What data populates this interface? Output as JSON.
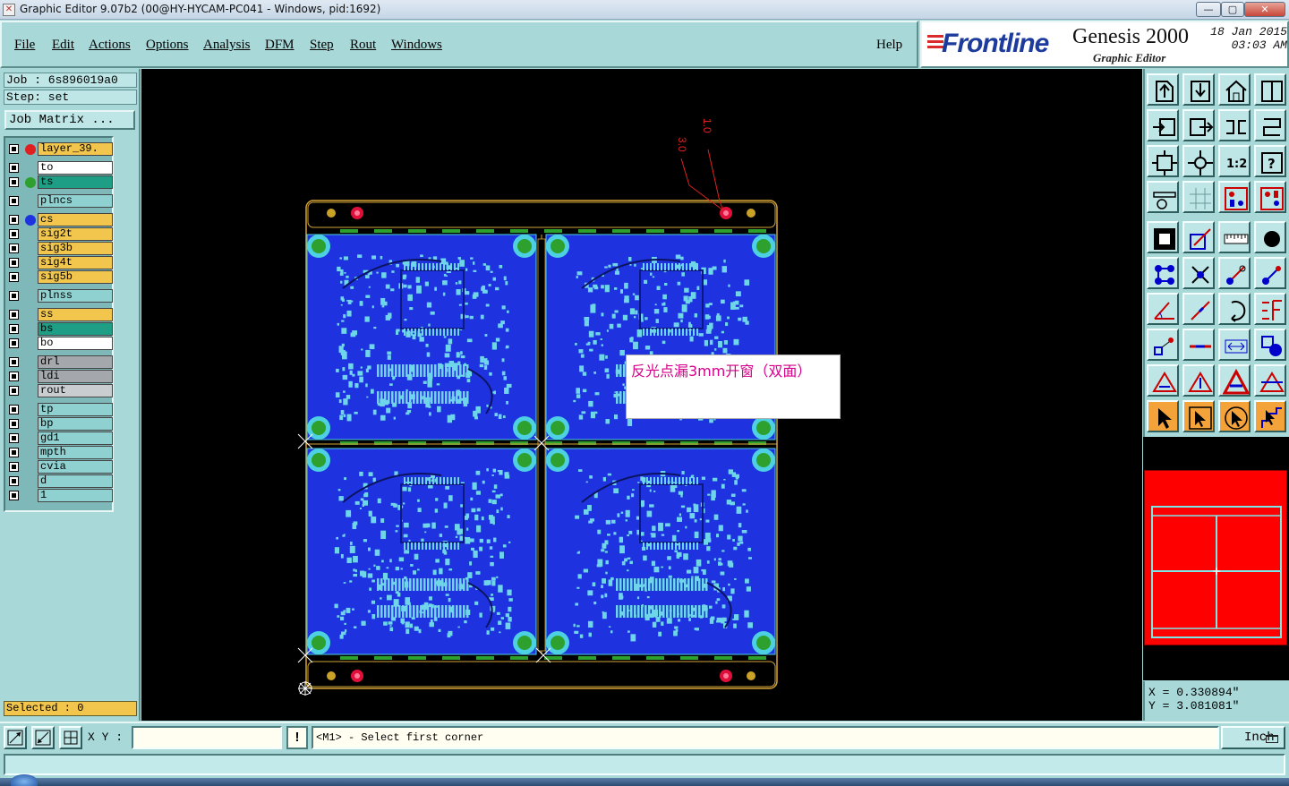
{
  "window": {
    "title": "Graphic Editor 9.07b2 (00@HY-HYCAM-PC041 - Windows, pid:1692)",
    "minimize": "—",
    "maximize": "▢",
    "close": "✕"
  },
  "menu": {
    "file": "File",
    "edit": "Edit",
    "actions": "Actions",
    "options": "Options",
    "analysis": "Analysis",
    "dfm": "DFM",
    "step": "Step",
    "rout": "Rout",
    "windows": "Windows",
    "help": "Help"
  },
  "brand": {
    "logo": "Frontline",
    "product": "Genesis 2000",
    "subtitle": "Graphic Editor",
    "date": "18 Jan 2015",
    "time": "03:03 AM"
  },
  "job": {
    "job_line": "Job : 6s896019a0",
    "step_line": "Step: set",
    "matrix_button": "Job Matrix ..."
  },
  "layers": [
    {
      "name": "layer_39.",
      "color": "#f2c64d",
      "dot": "#e02020"
    },
    {
      "name": "to",
      "color": "#ffffff",
      "dot": ""
    },
    {
      "name": "ts",
      "color": "#1f9e86",
      "dot": "#2ea02e"
    },
    {
      "name": "plncs",
      "color": "#8fd0d0",
      "dot": ""
    },
    {
      "name": "cs",
      "color": "#f2c64d",
      "dot": "#1e32e0"
    },
    {
      "name": "sig2t",
      "color": "#f2c64d",
      "dot": ""
    },
    {
      "name": "sig3b",
      "color": "#f2c64d",
      "dot": ""
    },
    {
      "name": "sig4t",
      "color": "#f2c64d",
      "dot": ""
    },
    {
      "name": "sig5b",
      "color": "#f2c64d",
      "dot": ""
    },
    {
      "name": "plnss",
      "color": "#8fd0d0",
      "dot": ""
    },
    {
      "name": "ss",
      "color": "#f2c64d",
      "dot": ""
    },
    {
      "name": "bs",
      "color": "#1f9e86",
      "dot": ""
    },
    {
      "name": "bo",
      "color": "#ffffff",
      "dot": ""
    },
    {
      "name": "drl",
      "color": "#a4a8ac",
      "dot": ""
    },
    {
      "name": "ldi",
      "color": "#a4a8ac",
      "dot": ""
    },
    {
      "name": "rout",
      "color": "#c9cdd0",
      "dot": ""
    },
    {
      "name": "tp",
      "color": "#8fd0d0",
      "dot": ""
    },
    {
      "name": "bp",
      "color": "#8fd0d0",
      "dot": ""
    },
    {
      "name": "gd1",
      "color": "#8fd0d0",
      "dot": ""
    },
    {
      "name": "mpth",
      "color": "#8fd0d0",
      "dot": ""
    },
    {
      "name": "cvia",
      "color": "#8fd0d0",
      "dot": ""
    },
    {
      "name": "d",
      "color": "#8fd0d0",
      "dot": ""
    },
    {
      "name": "1",
      "color": "#8fd0d0",
      "dot": ""
    }
  ],
  "selected": "Selected : 0",
  "canvas": {
    "annotation": "反光点漏3mm开窗（双面）",
    "dim1": "1.0",
    "dim2": "3.0"
  },
  "coords": {
    "x": "X = 0.330894\"",
    "y": "Y = 3.081081\""
  },
  "status": {
    "xy_label": "X Y :",
    "xy_value": "",
    "warn": "!",
    "prompt": "<M1> - Select first corner",
    "units": "Inch"
  },
  "colors": {
    "board": "#1e32e0",
    "accent": "#f2c64d",
    "panel": "#a8d8d8"
  }
}
